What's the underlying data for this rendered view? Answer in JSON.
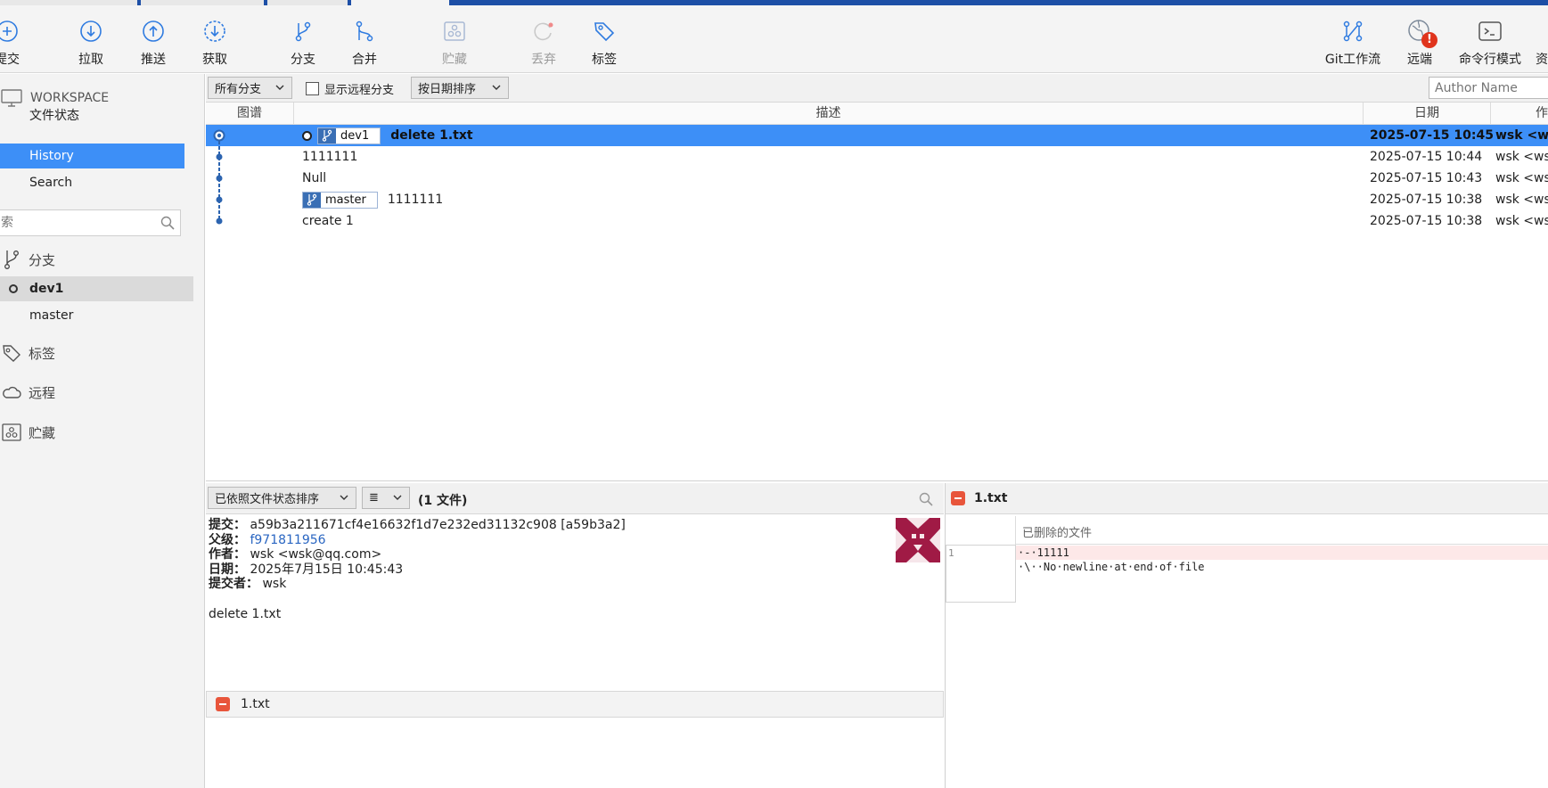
{
  "toolbar": {
    "commit": "提交",
    "pull": "拉取",
    "push": "推送",
    "fetch": "获取",
    "branch": "分支",
    "merge": "合并",
    "stash": "贮藏",
    "discard": "丢弃",
    "tag": "标签",
    "git_flow": "Git工作流",
    "remote": "远端",
    "terminal": "命令行模式",
    "explorer": "资"
  },
  "sidebar": {
    "workspace": "WORKSPACE",
    "items": [
      {
        "label": "文件状态"
      },
      {
        "label": "History"
      },
      {
        "label": "Search"
      }
    ],
    "search_placeholder": "索",
    "branches_title": "分支",
    "branches": [
      {
        "label": "dev1"
      },
      {
        "label": "master"
      }
    ],
    "tags_title": "标签",
    "remotes_title": "远程",
    "stashes_title": "贮藏"
  },
  "filter": {
    "branches": "所有分支",
    "show_remote": "显示远程分支",
    "sort": "按日期排序",
    "author_placeholder": "Author Name"
  },
  "columns": {
    "graph": "图谱",
    "description": "描述",
    "date": "日期",
    "author": "作"
  },
  "commits": [
    {
      "tag": "dev1",
      "message": "delete 1.txt",
      "date": "2025-07-15 10:45",
      "author": "wsk <wsk@qq.com>"
    },
    {
      "message": "1111111",
      "date": "2025-07-15 10:44",
      "author": "wsk <wsk@qq.com>"
    },
    {
      "message": "Null",
      "date": "2025-07-15 10:43",
      "author": "wsk <wsk@qq.com>"
    },
    {
      "tag": "master",
      "message": "1111111",
      "date": "2025-07-15 10:38",
      "author": "wsk <wsk@qq.com>"
    },
    {
      "message": "create 1",
      "date": "2025-07-15 10:38",
      "author": "wsk <wsk@qq.com>"
    }
  ],
  "details": {
    "sort_by_status": "已依照文件状态排序",
    "list_icon": "≣",
    "file_count": "(1 文件)",
    "commit_label": "提交：",
    "commit_value": "a59b3a211671cf4e16632f1d7e232ed31132c908 [a59b3a2]",
    "parent_label": "父级：",
    "parent_value": "f971811956",
    "author_label": "作者：",
    "author_value": "wsk <wsk@qq.com>",
    "date_label": "日期：",
    "date_value": "2025年7月15日 10:45:43",
    "committer_label": "提交者：",
    "committer_value": "wsk",
    "message": "delete 1.txt",
    "file_name": "1.txt"
  },
  "diff": {
    "file_name": "1.txt",
    "hunk_header": "已删除的文件",
    "line_number": "1",
    "lines": [
      "·-·11111",
      "·\\··No·newline·at·end·of·file"
    ]
  },
  "colors": {
    "selection": "#3d8ff7",
    "toolbar_icon": "#2f7be0",
    "removed_badge": "#e8553b",
    "tag_icon": "#3a6fb5",
    "avatar": "#a01a45"
  }
}
